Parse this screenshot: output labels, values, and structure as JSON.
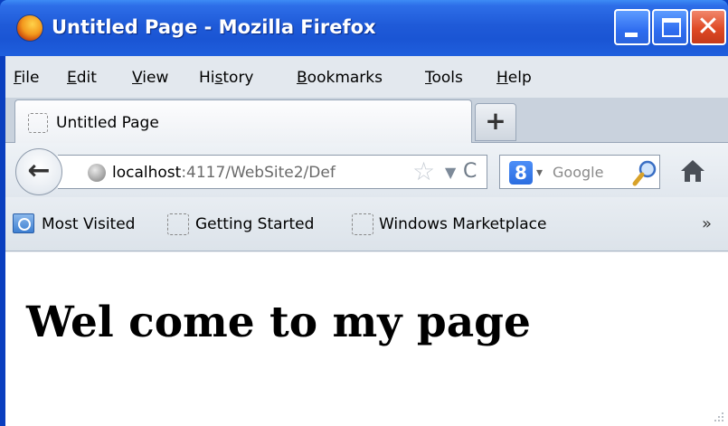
{
  "window": {
    "title": "Untitled Page - Mozilla Firefox",
    "controls": {
      "minimize": "",
      "maximize": "",
      "close": "✕"
    }
  },
  "menu": {
    "items": [
      {
        "label": "File",
        "access_key": "F"
      },
      {
        "label": "Edit",
        "access_key": "E"
      },
      {
        "label": "View",
        "access_key": "V"
      },
      {
        "label": "History",
        "access_key": "s"
      },
      {
        "label": "Bookmarks",
        "access_key": "B"
      },
      {
        "label": "Tools",
        "access_key": "T"
      },
      {
        "label": "Help",
        "access_key": "H"
      }
    ]
  },
  "tabs": {
    "active": {
      "label": "Untitled Page"
    },
    "new_tab": "+"
  },
  "navigation": {
    "back": "←",
    "url_host": "localhost",
    "url_rest": ":4117/WebSite2/Def",
    "star": "☆",
    "dropmarker": "▼",
    "reload": "C"
  },
  "search": {
    "engine": "8",
    "dropdown": "▾",
    "placeholder": "Google"
  },
  "bookmarks": {
    "items": [
      {
        "label": "Most Visited"
      },
      {
        "label": "Getting Started"
      },
      {
        "label": "Windows Marketplace"
      }
    ],
    "overflow": "»"
  },
  "content": {
    "heading": "Wel come to my page"
  },
  "colors": {
    "titlebar": "#1f5ad8",
    "close_button": "#df4a25",
    "menubar": "#e3e8ee"
  },
  "icons": [
    "firefox-logo-icon",
    "minimize-icon",
    "maximize-icon",
    "close-icon",
    "new-tab-icon",
    "back-arrow-icon",
    "globe-icon",
    "star-icon",
    "dropmarker-icon",
    "reload-icon",
    "google-icon",
    "magnifier-icon",
    "home-icon",
    "folder-icon",
    "page-icon",
    "chevron-icon"
  ]
}
